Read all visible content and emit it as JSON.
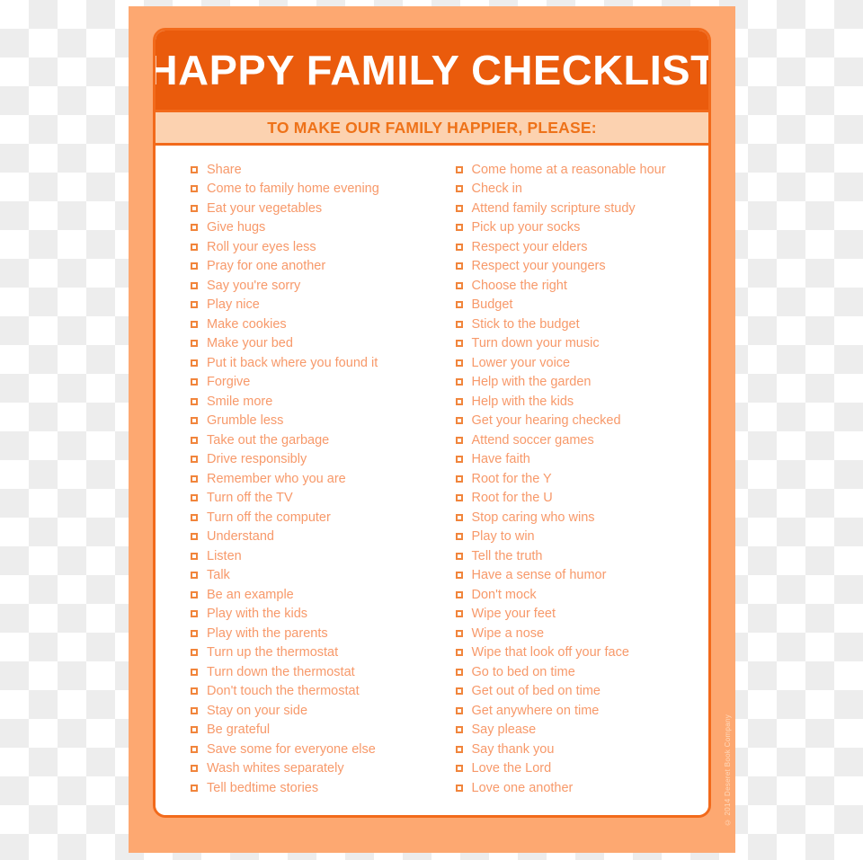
{
  "poster": {
    "header": {
      "title": "HAPPY FAMILY CHECKLIST",
      "subtitle": "TO MAKE OUR FAMILY HAPPIER, PLEASE:"
    },
    "copyright": "© 2014 Deseret Book Company",
    "colors": {
      "outer_panel": "#fda871",
      "header_bar": "#ea5b0c",
      "subtitle_bar": "#fcd2b0",
      "rule": "#f26a1b",
      "item_text": "#f7996a",
      "subtitle_text": "#ee7219",
      "checkbox_border": "#f1853c",
      "card_background": "#ffffff"
    },
    "columns": {
      "left": [
        "Share",
        "Come to family home evening",
        "Eat your vegetables",
        "Give hugs",
        "Roll your eyes less",
        "Pray for one another",
        "Say you're sorry",
        "Play nice",
        "Make cookies",
        "Make your bed",
        "Put it back where you found it",
        "Forgive",
        "Smile more",
        "Grumble less",
        "Take out the garbage",
        "Drive responsibly",
        "Remember who you are",
        "Turn off the TV",
        "Turn off the computer",
        "Understand",
        "Listen",
        "Talk",
        "Be an example",
        "Play with the kids",
        "Play with the parents",
        "Turn up the thermostat",
        "Turn down the thermostat",
        "Don't touch the thermostat",
        "Stay on your side",
        "Be grateful",
        "Save some for everyone else",
        "Wash whites separately",
        "Tell bedtime stories"
      ],
      "right": [
        "Come home at a reasonable hour",
        "Check in",
        "Attend family scripture study",
        "Pick up your socks",
        "Respect your elders",
        "Respect your youngers",
        "Choose the right",
        "Budget",
        "Stick to the budget",
        "Turn down your music",
        "Lower your voice",
        "Help with the garden",
        "Help with the kids",
        "Get your hearing checked",
        "Attend soccer games",
        "Have faith",
        "Root for the Y",
        "Root for the U",
        "Stop caring who wins",
        "Play to win",
        "Tell the truth",
        "Have a sense of humor",
        "Don't mock",
        "Wipe your feet",
        "Wipe a nose",
        "Wipe that look off your face",
        "Go to bed on time",
        "Get out of bed on time",
        "Get anywhere on time",
        "Say please",
        "Say thank you",
        "Love the Lord",
        "Love one another"
      ]
    }
  }
}
